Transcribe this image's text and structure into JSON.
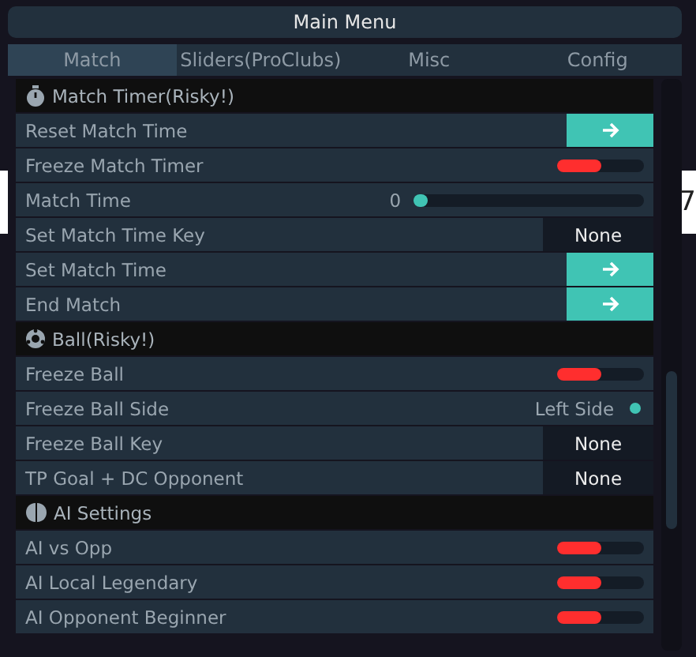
{
  "backdrop": {
    "text": "7"
  },
  "window": {
    "title": "Main Menu"
  },
  "tabs": [
    {
      "label": "Match",
      "selected": true
    },
    {
      "label": "Sliders(ProClubs)",
      "selected": false
    },
    {
      "label": "Misc",
      "selected": false
    },
    {
      "label": "Config",
      "selected": false
    }
  ],
  "items": [
    {
      "kind": "header",
      "label": "Match Timer(Risky!)"
    },
    {
      "kind": "button",
      "label": "Reset Match Time"
    },
    {
      "kind": "toggle",
      "label": "Freeze Match Timer",
      "on": false
    },
    {
      "kind": "slider",
      "label": "Match Time",
      "reading": "0",
      "level": 0
    },
    {
      "kind": "key",
      "label": "Set Match Time Key",
      "value": "None"
    },
    {
      "kind": "button",
      "label": "Set Match Time"
    },
    {
      "kind": "button",
      "label": "End Match"
    },
    {
      "kind": "header",
      "label": "Ball(Risky!)"
    },
    {
      "kind": "toggle",
      "label": "Freeze Ball",
      "on": false
    },
    {
      "kind": "choice",
      "label": "Freeze Ball Side",
      "value": "Left Side",
      "selected": true
    },
    {
      "kind": "key",
      "label": "Freeze Ball Key",
      "value": "None"
    },
    {
      "kind": "key",
      "label": "TP Goal + DC Opponent",
      "value": "None"
    },
    {
      "kind": "header",
      "label": "AI Settings"
    },
    {
      "kind": "toggle",
      "label": "AI vs Opp",
      "on": false
    },
    {
      "kind": "toggle",
      "label": "AI Local Legendary",
      "on": false
    },
    {
      "kind": "toggle",
      "label": "AI Opponent Beginner",
      "on": false
    }
  ]
}
